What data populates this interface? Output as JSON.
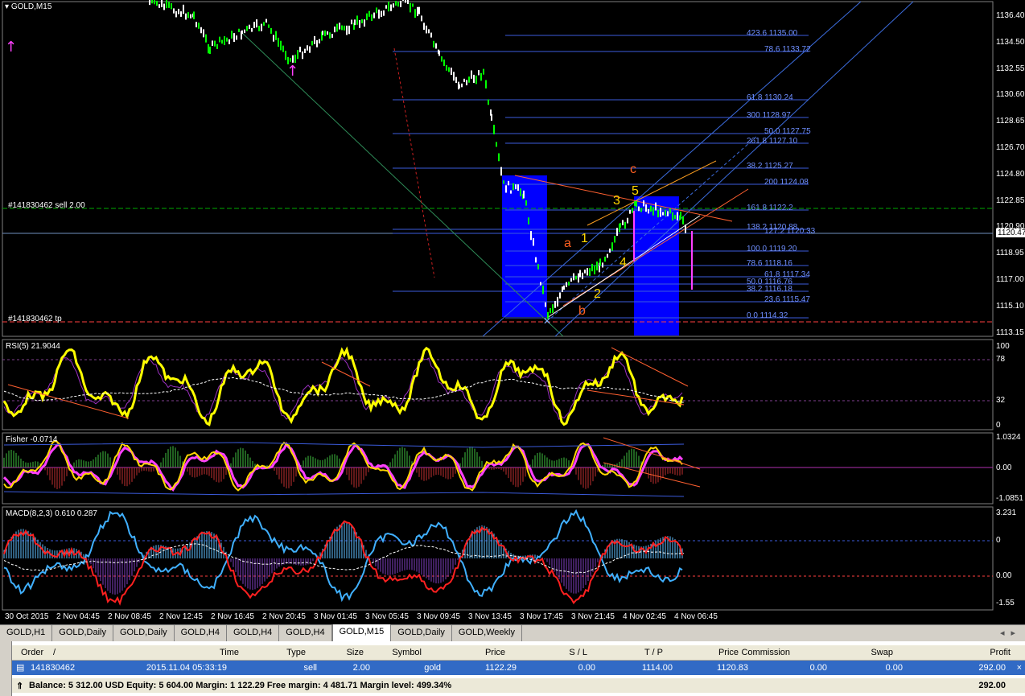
{
  "chart": {
    "symbol_label": "GOLD,M15",
    "sell_line_label": "#141830462 sell 2.00",
    "tp_line_label": "#141830462 tp",
    "current_price": "1120.47",
    "price_scale": [
      "1136.40",
      "1134.50",
      "1132.55",
      "1130.60",
      "1128.65",
      "1126.70",
      "1124.80",
      "1122.85",
      "1120.90",
      "1118.95",
      "1117.00",
      "1115.10",
      "1113.15"
    ],
    "fib_labels": [
      "423.6 1135.00",
      "78.6 1133.72",
      "61.8 1130.24",
      "300 1128.97",
      "50.0 1127.75",
      "261.8 1127.10",
      "38.2 1125.27",
      "200 1124.08",
      "161.8 1122.2",
      "138.2 1120.88",
      "127.2 1120.33",
      "100.0 1119.20",
      "78.6 1118.16",
      "61.8 1117.34",
      "50.0 1116.76",
      "38.2 1116.18",
      "23.6 1115.47",
      "0.0 1114.32"
    ],
    "wave_labels": [
      "c",
      "3",
      "5",
      "a",
      "1",
      "4",
      "2",
      "b"
    ],
    "time_axis": [
      "30 Oct 2015",
      "2 Nov 04:45",
      "2 Nov 08:45",
      "2 Nov 12:45",
      "2 Nov 16:45",
      "2 Nov 20:45",
      "3 Nov 01:45",
      "3 Nov 05:45",
      "3 Nov 09:45",
      "3 Nov 13:45",
      "3 Nov 17:45",
      "3 Nov 21:45",
      "4 Nov 02:45",
      "4 Nov 06:45"
    ]
  },
  "rsi": {
    "label": "RSI(5) 21.9044",
    "scale": [
      "100",
      "78",
      "32",
      "0"
    ]
  },
  "fisher": {
    "label": "Fisher -0.0714",
    "scale": [
      "1.0324",
      "0.00",
      "-1.0851"
    ]
  },
  "macd": {
    "label": "MACD(8,2,3) 0.610 0.287",
    "scale": [
      "3.231",
      "0",
      "0.00",
      "-1.55"
    ]
  },
  "tabs": [
    "GOLD,H1",
    "GOLD,Daily",
    "GOLD,Daily",
    "GOLD,H4",
    "GOLD,H4",
    "GOLD,H4",
    "GOLD,M15",
    "GOLD,Daily",
    "GOLD,Weekly"
  ],
  "active_tab": 6,
  "terminal": {
    "headers": [
      "Order",
      "/",
      "Time",
      "Type",
      "Size",
      "Symbol",
      "Price",
      "S / L",
      "T / P",
      "Price",
      "Commission",
      "Swap",
      "Profit"
    ],
    "row": [
      "141830462",
      "2015.11.04 05:33:19",
      "sell",
      "2.00",
      "gold",
      "1122.29",
      "0.00",
      "1114.00",
      "1120.83",
      "0.00",
      "0.00",
      "292.00"
    ],
    "balance_text": "Balance: 5 312.00 USD  Equity: 5 604.00  Margin: 1 122.29  Free margin: 4 481.71  Margin level: 499.34%",
    "balance_profit": "292.00"
  },
  "colors": {
    "bull_candle": "#00ff00",
    "rsi_line": "#ffff00",
    "box_fill": "#0000ff",
    "grid_line": "#3b5bdb"
  }
}
